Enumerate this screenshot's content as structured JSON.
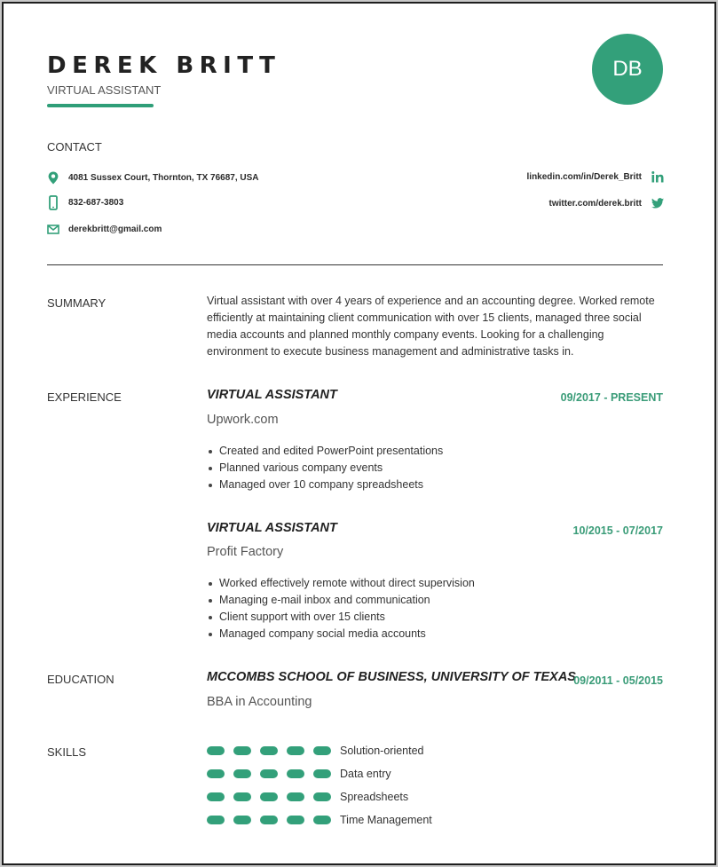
{
  "header": {
    "name": "DEREK BRITT",
    "title": "VIRTUAL ASSISTANT",
    "initials": "DB"
  },
  "colors": {
    "accent": "#33a07a",
    "text": "#333333"
  },
  "contact": {
    "heading": "CONTACT",
    "address": {
      "icon": "map-pin-icon",
      "text": "4081 Sussex Court, Thornton, TX 76687, USA"
    },
    "phone": {
      "icon": "phone-icon",
      "text": "832-687-3803"
    },
    "email": {
      "icon": "mail-icon",
      "text": "derekbritt@gmail.com"
    },
    "linkedin": {
      "icon": "linkedin-icon",
      "text": "linkedin.com/in/Derek_Britt"
    },
    "twitter": {
      "icon": "twitter-icon",
      "text": "twitter.com/derek.britt"
    }
  },
  "summary": {
    "label": "SUMMARY",
    "text": "Virtual assistant with over 4 years of experience and an accounting degree. Worked remote efficiently at maintaining client communication with over 15 clients, managed three social media accounts and planned monthly company events. Looking for a challenging environment to execute business management and administrative tasks in."
  },
  "experience": {
    "label": "EXPERIENCE",
    "jobs": [
      {
        "title": "VIRTUAL ASSISTANT",
        "company": "Upwork.com",
        "dates": "09/2017 - PRESENT",
        "bullets": [
          "Created and edited PowerPoint presentations",
          "Planned various company events",
          "Managed over 10 company spreadsheets"
        ]
      },
      {
        "title": "VIRTUAL ASSISTANT",
        "company": "Profit Factory",
        "dates": "10/2015 - 07/2017",
        "bullets": [
          "Worked effectively remote without direct supervision",
          "Managing e-mail inbox and communication",
          "Client support with over 15 clients",
          "Managed company social media accounts"
        ]
      }
    ]
  },
  "education": {
    "label": "EDUCATION",
    "school": "MCCOMBS SCHOOL OF BUSINESS, UNIVERSITY OF TEXAS",
    "dates": "09/2011 - 05/2015",
    "degree": "BBA in Accounting"
  },
  "skills": {
    "label": "SKILLS",
    "max_level": 5,
    "items": [
      {
        "name": "Solution-oriented",
        "level": 5
      },
      {
        "name": "Data entry",
        "level": 5
      },
      {
        "name": "Spreadsheets",
        "level": 5
      },
      {
        "name": "Time Management",
        "level": 5
      }
    ]
  }
}
